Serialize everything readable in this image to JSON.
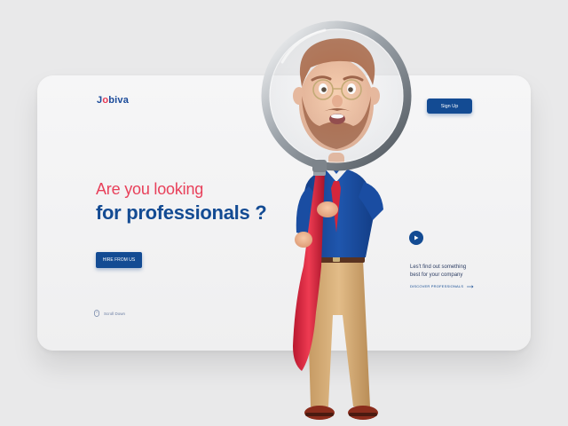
{
  "brand": {
    "logo_prefix": "J",
    "logo_o": "o",
    "logo_suffix": "biva",
    "primary_color": "#134b93",
    "accent_color": "#e8405a"
  },
  "header": {
    "signup_label": "Sign Up"
  },
  "hero": {
    "headline_line1": "Are you looking",
    "headline_line2": "for professionals ?",
    "cta_label": "HIRE FROM US"
  },
  "footer": {
    "scroll_label": "Scroll Down",
    "scroll_icon": "mouse-icon"
  },
  "side": {
    "play_icon": "play-icon",
    "tagline_line1": "Les't find out something",
    "tagline_line2": "best for your company",
    "discover_label": "DISCOVER PROFESSIONALS",
    "discover_icon": "arrow-right-icon"
  }
}
